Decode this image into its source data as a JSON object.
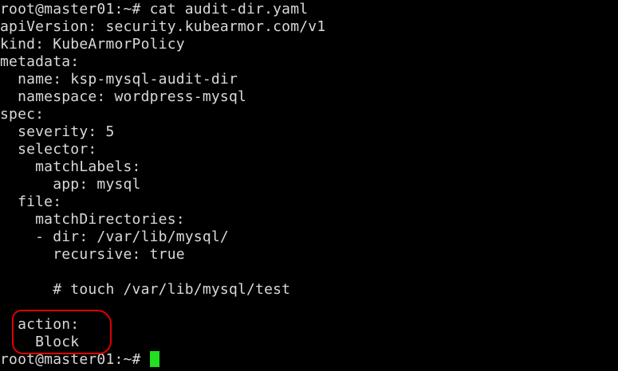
{
  "terminal": {
    "lines": [
      "root@master01:~# cat audit-dir.yaml",
      "apiVersion: security.kubearmor.com/v1",
      "kind: KubeArmorPolicy",
      "metadata:",
      "  name: ksp-mysql-audit-dir",
      "  namespace: wordpress-mysql",
      "spec:",
      "  severity: 5",
      "  selector:",
      "    matchLabels:",
      "      app: mysql",
      "  file:",
      "    matchDirectories:",
      "    - dir: /var/lib/mysql/",
      "      recursive: true",
      "",
      "      # touch /var/lib/mysql/test",
      "",
      "  action:",
      "    Block"
    ],
    "prompt": "root@master01:~# ",
    "colors": {
      "background": "#000000",
      "text": "#d9d9d9",
      "cursor": "#21e021",
      "highlight": "#e00000"
    }
  }
}
